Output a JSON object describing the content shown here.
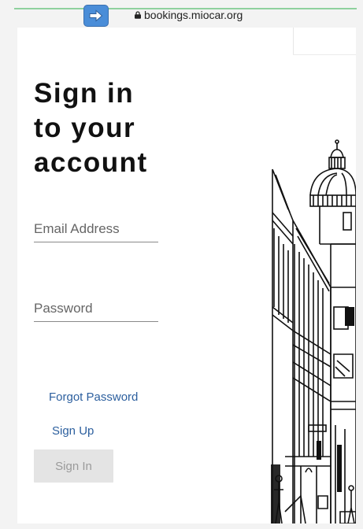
{
  "browser": {
    "url": "bookings.miocar.org",
    "nav_icon": "arrow-right-icon",
    "lock_icon": "lock-icon"
  },
  "signin": {
    "title_lines": [
      "Sign in",
      "to your",
      "account"
    ],
    "email_label": "Email Address",
    "password_label": "Password",
    "forgot_password": "Forgot Password",
    "sign_up": "Sign Up",
    "sign_in_button": "Sign In"
  },
  "colors": {
    "link": "#2c5f9e",
    "button_bg": "#e4e4e4",
    "button_text": "#9a9a9a",
    "nav_button": "#4a8dd8"
  },
  "illustration": {
    "icon": "building-sketch-icon"
  }
}
